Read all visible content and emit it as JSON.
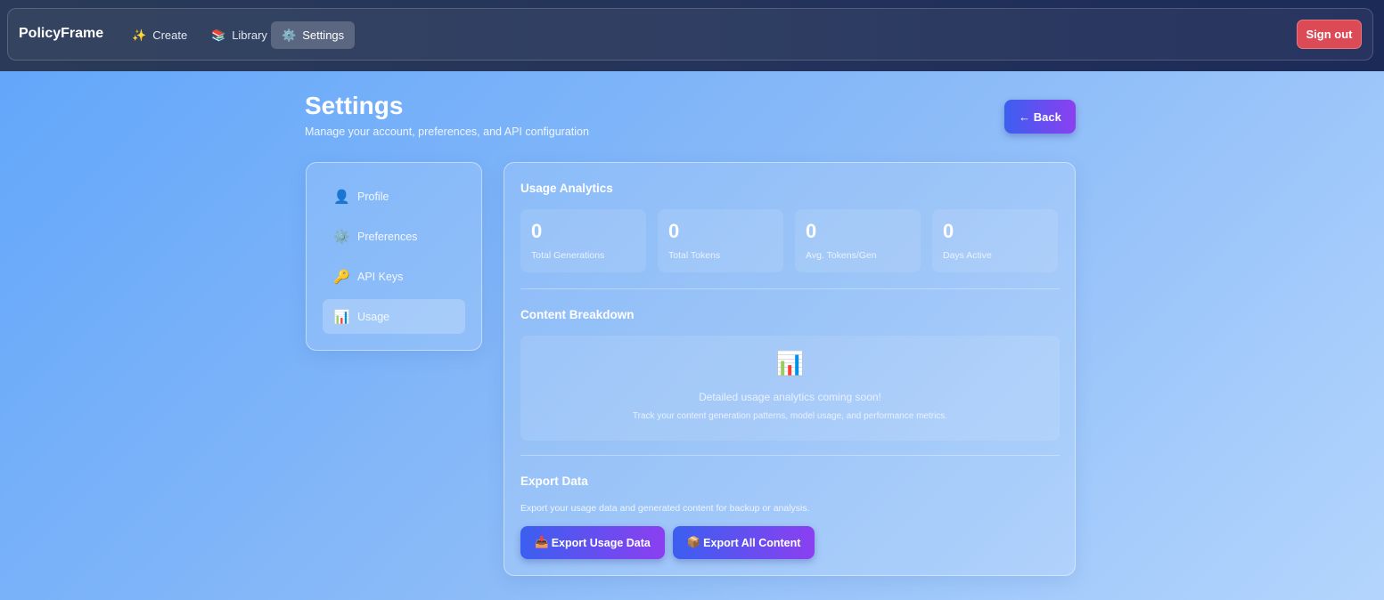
{
  "navbar": {
    "brand": "PolicyFrame",
    "links": [
      {
        "icon": "✨",
        "icon_name": "sparkles-icon",
        "label": "Create"
      },
      {
        "icon": "📚",
        "icon_name": "books-icon",
        "label": "Library"
      },
      {
        "icon": "⚙️",
        "icon_name": "gear-icon",
        "label": "Settings",
        "active": true
      }
    ],
    "sign_out": "Sign out"
  },
  "header": {
    "title": "Settings",
    "subtitle": "Manage your account, preferences, and API configuration",
    "back_label": "← Back"
  },
  "sidebar": {
    "items": [
      {
        "icon": "👤",
        "icon_name": "user-icon",
        "label": "Profile"
      },
      {
        "icon": "⚙️",
        "icon_name": "gear-icon",
        "label": "Preferences"
      },
      {
        "icon": "🔑",
        "icon_name": "key-icon",
        "label": "API Keys"
      },
      {
        "icon": "📊",
        "icon_name": "bar-chart-icon",
        "label": "Usage",
        "active": true
      }
    ]
  },
  "usage": {
    "title": "Usage Analytics",
    "stats": [
      {
        "value": "0",
        "label": "Total Generations"
      },
      {
        "value": "0",
        "label": "Total Tokens"
      },
      {
        "value": "0",
        "label": "Avg. Tokens/Gen"
      },
      {
        "value": "0",
        "label": "Days Active"
      }
    ]
  },
  "breakdown": {
    "title": "Content Breakdown",
    "icon": "📊",
    "message": "Detailed usage analytics coming soon!",
    "detail": "Track your content generation patterns, model usage, and performance metrics."
  },
  "export": {
    "title": "Export Data",
    "description": "Export your usage data and generated content for backup or analysis.",
    "buttons": [
      {
        "icon": "📥",
        "icon_name": "inbox-tray-icon",
        "label": "Export Usage Data"
      },
      {
        "icon": "📦",
        "icon_name": "package-icon",
        "label": "Export All Content"
      }
    ]
  },
  "colors": {
    "accent_gradient_start": "#3b5ff0",
    "accent_gradient_end": "#8b3ff0",
    "sign_out": "#dc4a55"
  }
}
